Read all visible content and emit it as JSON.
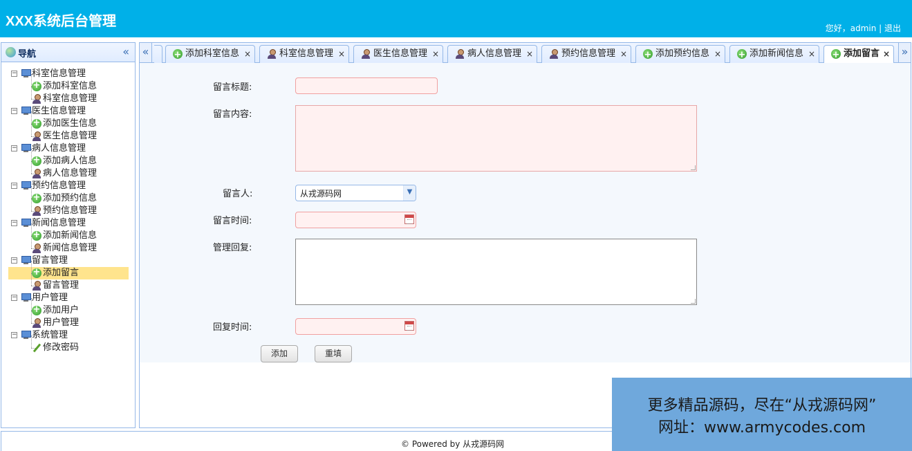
{
  "header": {
    "title": "XXX系统后台管理",
    "user_text": "您好，admin | 退出"
  },
  "sidebar": {
    "title": "导航",
    "collapse_icon": "«",
    "groups": [
      {
        "label": "科室信息管理",
        "children": [
          {
            "label": "添加科室信息",
            "icon": "add-icon"
          },
          {
            "label": "科室信息管理",
            "icon": "user-icon"
          }
        ]
      },
      {
        "label": "医生信息管理",
        "children": [
          {
            "label": "添加医生信息",
            "icon": "add-icon"
          },
          {
            "label": "医生信息管理",
            "icon": "user-icon"
          }
        ]
      },
      {
        "label": "病人信息管理",
        "children": [
          {
            "label": "添加病人信息",
            "icon": "add-icon"
          },
          {
            "label": "病人信息管理",
            "icon": "user-icon"
          }
        ]
      },
      {
        "label": "预约信息管理",
        "children": [
          {
            "label": "添加预约信息",
            "icon": "add-icon"
          },
          {
            "label": "预约信息管理",
            "icon": "user-icon"
          }
        ]
      },
      {
        "label": "新闻信息管理",
        "children": [
          {
            "label": "添加新闻信息",
            "icon": "add-icon"
          },
          {
            "label": "新闻信息管理",
            "icon": "user-icon"
          }
        ]
      },
      {
        "label": "留言管理",
        "children": [
          {
            "label": "添加留言",
            "icon": "add-icon",
            "selected": true
          },
          {
            "label": "留言管理",
            "icon": "user-icon"
          }
        ]
      },
      {
        "label": "用户管理",
        "children": [
          {
            "label": "添加用户",
            "icon": "add-icon"
          },
          {
            "label": "用户管理",
            "icon": "user-icon"
          }
        ]
      },
      {
        "label": "系统管理",
        "children": [
          {
            "label": "修改密码",
            "icon": "pencil-icon"
          }
        ]
      }
    ]
  },
  "tabs": {
    "scroll_left": "«",
    "scroll_right": "»",
    "items": [
      {
        "label": "添加科室信息",
        "icon": "add-icon"
      },
      {
        "label": "科室信息管理",
        "icon": "user-icon"
      },
      {
        "label": "医生信息管理",
        "icon": "user-icon"
      },
      {
        "label": "病人信息管理",
        "icon": "user-icon"
      },
      {
        "label": "预约信息管理",
        "icon": "user-icon"
      },
      {
        "label": "添加预约信息",
        "icon": "add-icon"
      },
      {
        "label": "添加新闻信息",
        "icon": "add-icon"
      },
      {
        "label": "添加留言",
        "icon": "add-icon",
        "active": true
      }
    ],
    "close_glyph": "×"
  },
  "form": {
    "title_label": "留言标题:",
    "title_value": "",
    "content_label": "留言内容:",
    "content_value": "",
    "author_label": "留言人:",
    "author_value": "从戎源码网",
    "time_label": "留言时间:",
    "time_value": "",
    "reply_label": "管理回复:",
    "reply_value": "",
    "reply_time_label": "回复时间:",
    "reply_time_value": "",
    "submit_label": "添加",
    "reset_label": "重填"
  },
  "footer": {
    "copyright": "© Powered by 从戎源码网"
  },
  "banner": {
    "line1": "更多精品源码，尽在“从戎源码网”",
    "line2": "网址：www.armycodes.com"
  },
  "colors": {
    "header_bg": "#00b0e8",
    "border": "#95b8e7",
    "selected_bg": "#ffe48d",
    "invalid_bg": "#fff1f1",
    "banner_bg": "#6fa8dc"
  }
}
